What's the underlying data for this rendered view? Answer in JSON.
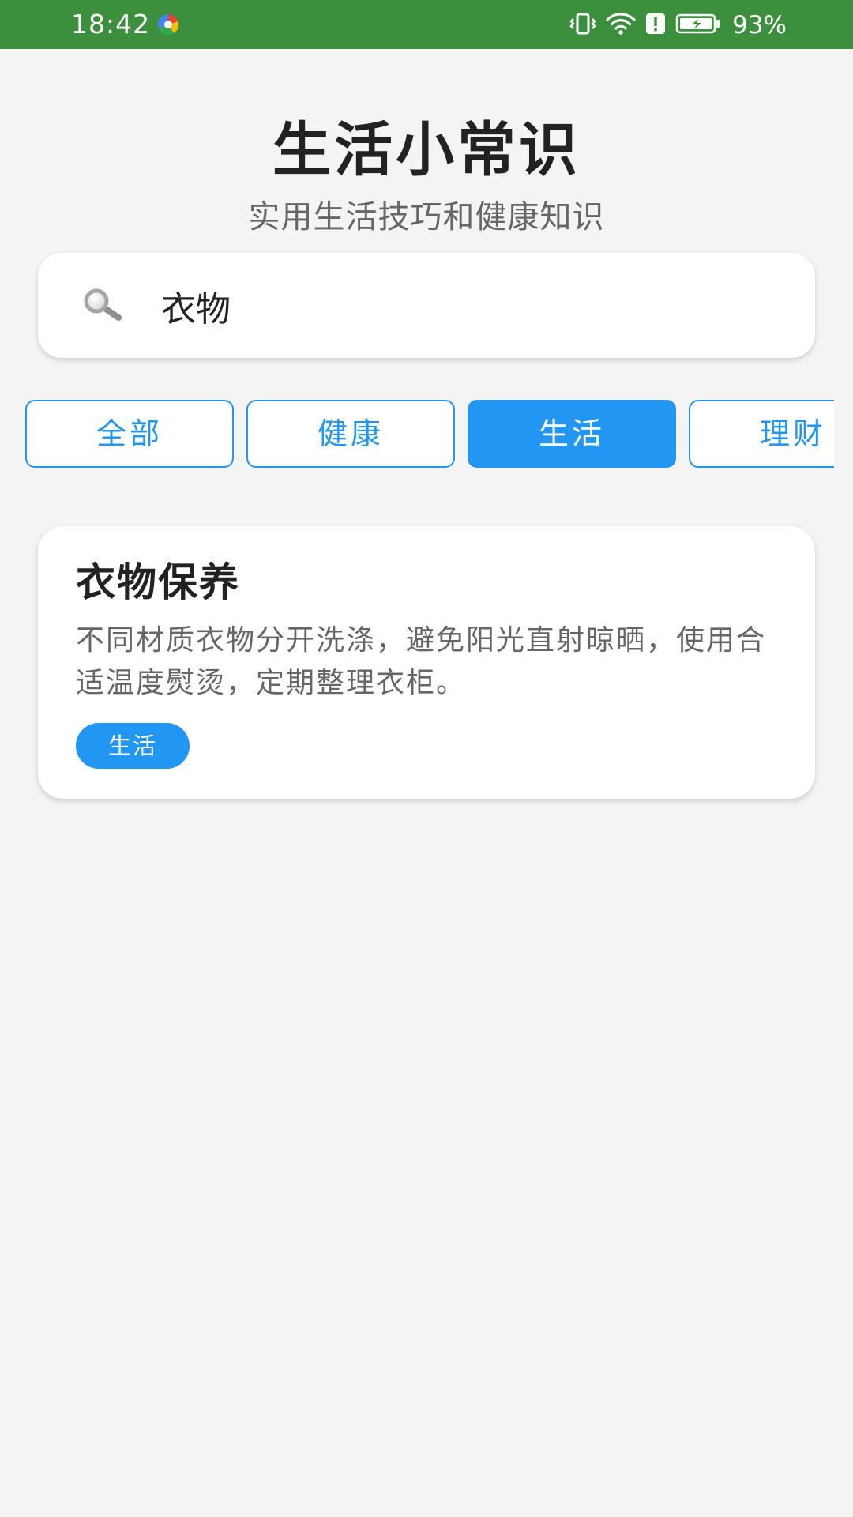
{
  "status_bar": {
    "time": "18:42",
    "battery_percent": "93%",
    "icons": [
      "app-notification-icon",
      "vibrate-icon",
      "wifi-icon",
      "alert-icon",
      "battery-charging-icon"
    ]
  },
  "header": {
    "title": "生活小常识",
    "subtitle": "实用生活技巧和健康知识"
  },
  "search": {
    "value": "衣物",
    "icon": "search-icon"
  },
  "tabs": [
    {
      "label": "全部",
      "active": false
    },
    {
      "label": "健康",
      "active": false
    },
    {
      "label": "生活",
      "active": true
    },
    {
      "label": "理财",
      "active": false
    }
  ],
  "results": [
    {
      "title": "衣物保养",
      "body": "不同材质衣物分开洗涤，避免阳光直射晾晒，使用合适温度熨烫，定期整理衣柜。",
      "tag": "生活"
    }
  ],
  "colors": {
    "status_bar": "#3b8f3d",
    "accent": "#2196f3",
    "background": "#f4f4f4",
    "title_text": "#222222",
    "secondary_text": "#666666"
  }
}
